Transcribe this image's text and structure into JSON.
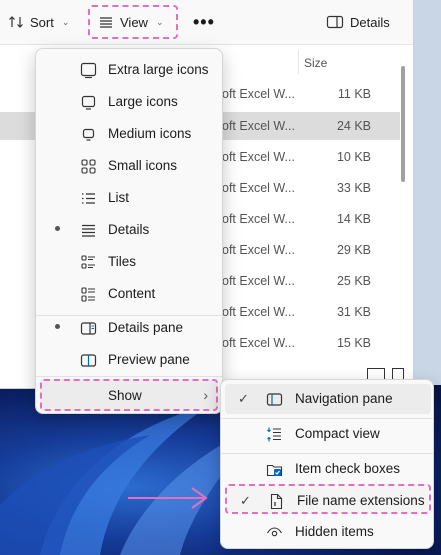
{
  "toolbar": {
    "sort_label": "Sort",
    "view_label": "View",
    "more_label": "•••",
    "details_label": "Details"
  },
  "columns": {
    "size_header": "Size"
  },
  "rows": [
    {
      "type": "oft Excel W...",
      "size": "11 KB",
      "selected": false
    },
    {
      "type": "oft Excel W...",
      "size": "24 KB",
      "selected": true
    },
    {
      "type": "oft Excel W...",
      "size": "10 KB",
      "selected": false
    },
    {
      "type": "oft Excel W...",
      "size": "33 KB",
      "selected": false
    },
    {
      "type": "oft Excel W...",
      "size": "14 KB",
      "selected": false
    },
    {
      "type": "oft Excel W...",
      "size": "29 KB",
      "selected": false
    },
    {
      "type": "oft Excel W...",
      "size": "25 KB",
      "selected": false
    },
    {
      "type": "oft Excel W...",
      "size": "31 KB",
      "selected": false
    },
    {
      "type": "oft Excel W...",
      "size": "15 KB",
      "selected": false
    }
  ],
  "view_menu": {
    "items": [
      {
        "label": "Extra large icons",
        "icon": "extra-large-icons-icon",
        "selected": false
      },
      {
        "label": "Large icons",
        "icon": "large-icons-icon",
        "selected": false
      },
      {
        "label": "Medium icons",
        "icon": "medium-icons-icon",
        "selected": false
      },
      {
        "label": "Small icons",
        "icon": "small-icons-icon",
        "selected": false
      },
      {
        "label": "List",
        "icon": "list-icon",
        "selected": false
      },
      {
        "label": "Details",
        "icon": "details-icon",
        "selected": true
      },
      {
        "label": "Tiles",
        "icon": "tiles-icon",
        "selected": false
      },
      {
        "label": "Content",
        "icon": "content-icon",
        "selected": false
      }
    ],
    "pane_items": [
      {
        "label": "Details pane",
        "icon": "details-pane-icon",
        "selected": true
      },
      {
        "label": "Preview pane",
        "icon": "preview-pane-icon",
        "selected": false
      }
    ],
    "show_label": "Show"
  },
  "show_menu": {
    "items": [
      {
        "label": "Navigation pane",
        "icon": "navigation-pane-icon",
        "checked": true
      },
      {
        "label": "Compact view",
        "icon": "compact-view-icon",
        "checked": false
      },
      {
        "label": "Item check boxes",
        "icon": "item-check-boxes-icon",
        "checked": false
      },
      {
        "label": "File name extensions",
        "icon": "file-extension-icon",
        "checked": true
      },
      {
        "label": "Hidden items",
        "icon": "hidden-items-icon",
        "checked": false
      }
    ]
  },
  "colors": {
    "highlight_dash": "#e36fc0",
    "accent": "#0067c0"
  }
}
